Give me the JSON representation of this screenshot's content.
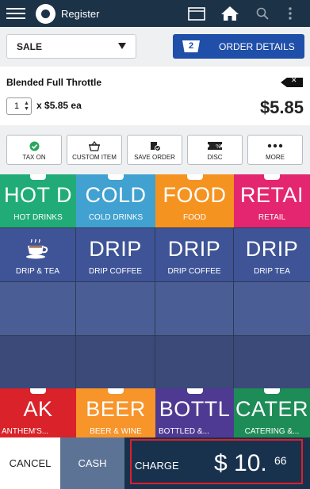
{
  "topbar": {
    "title": "Register",
    "icons": [
      "menu-icon",
      "logo-icon",
      "cash-drawer-icon",
      "home-icon",
      "search-icon",
      "more-vertical-icon"
    ]
  },
  "sale_select": {
    "value": "SALE"
  },
  "order_details": {
    "count": "2",
    "label": "ORDER DETAILS"
  },
  "item": {
    "name": "Blended Full Throttle",
    "quantity": "1",
    "multiply": "x",
    "unit_price": "$5.85 ea",
    "total": "$5.85"
  },
  "actions": [
    {
      "label": "TAX ON",
      "icon": "check-circle-icon"
    },
    {
      "label": "CUSTOM ITEM",
      "icon": "basket-icon"
    },
    {
      "label": "SAVE ORDER",
      "icon": "save-order-icon"
    },
    {
      "label": "DISC",
      "icon": "discount-ticket-icon"
    },
    {
      "label": "MORE",
      "icon": "more-horizontal-icon"
    }
  ],
  "tiles": [
    {
      "big": "HOT D",
      "small": "HOT DRINKS",
      "color": "#21ac77"
    },
    {
      "big": "COLD",
      "small": "COLD DRINKS",
      "color": "#41a1d0"
    },
    {
      "big": "FOOD",
      "small": "FOOD",
      "color": "#f59321"
    },
    {
      "big": "RETAI",
      "small": "RETAIL",
      "color": "#e3266f"
    },
    {
      "big": "",
      "small": "DRIP & TEA",
      "color": "#3f5496",
      "icon": "coffee-cup-icon"
    },
    {
      "big": "DRIP",
      "small": "DRIP COFFEE",
      "color": "#3f5496"
    },
    {
      "big": "DRIP",
      "small": "DRIP COFFEE",
      "color": "#3f5496"
    },
    {
      "big": "DRIP",
      "small": "DRIP TEA",
      "color": "#3f5496"
    },
    {
      "big": "AK",
      "small": "ANTHEM'S...",
      "color": "#d92229"
    },
    {
      "big": "BEER",
      "small": "BEER & WINE",
      "color": "#f7942a"
    },
    {
      "big": "BOTTL",
      "small": "BOTTLED &...",
      "color": "#4f3a93"
    },
    {
      "big": "CATER",
      "small": "CATERING &...",
      "color": "#1e8c57"
    }
  ],
  "bottom": {
    "cancel": "CANCEL",
    "cash": "CASH",
    "charge": "CHARGE",
    "amount": "$ 10.",
    "cents": "66"
  },
  "colors": {
    "topbar": "#1c3247",
    "accent_blue": "#1f4fa8",
    "charge_bg": "#18324d",
    "charge_highlight": "#e11d2b"
  }
}
